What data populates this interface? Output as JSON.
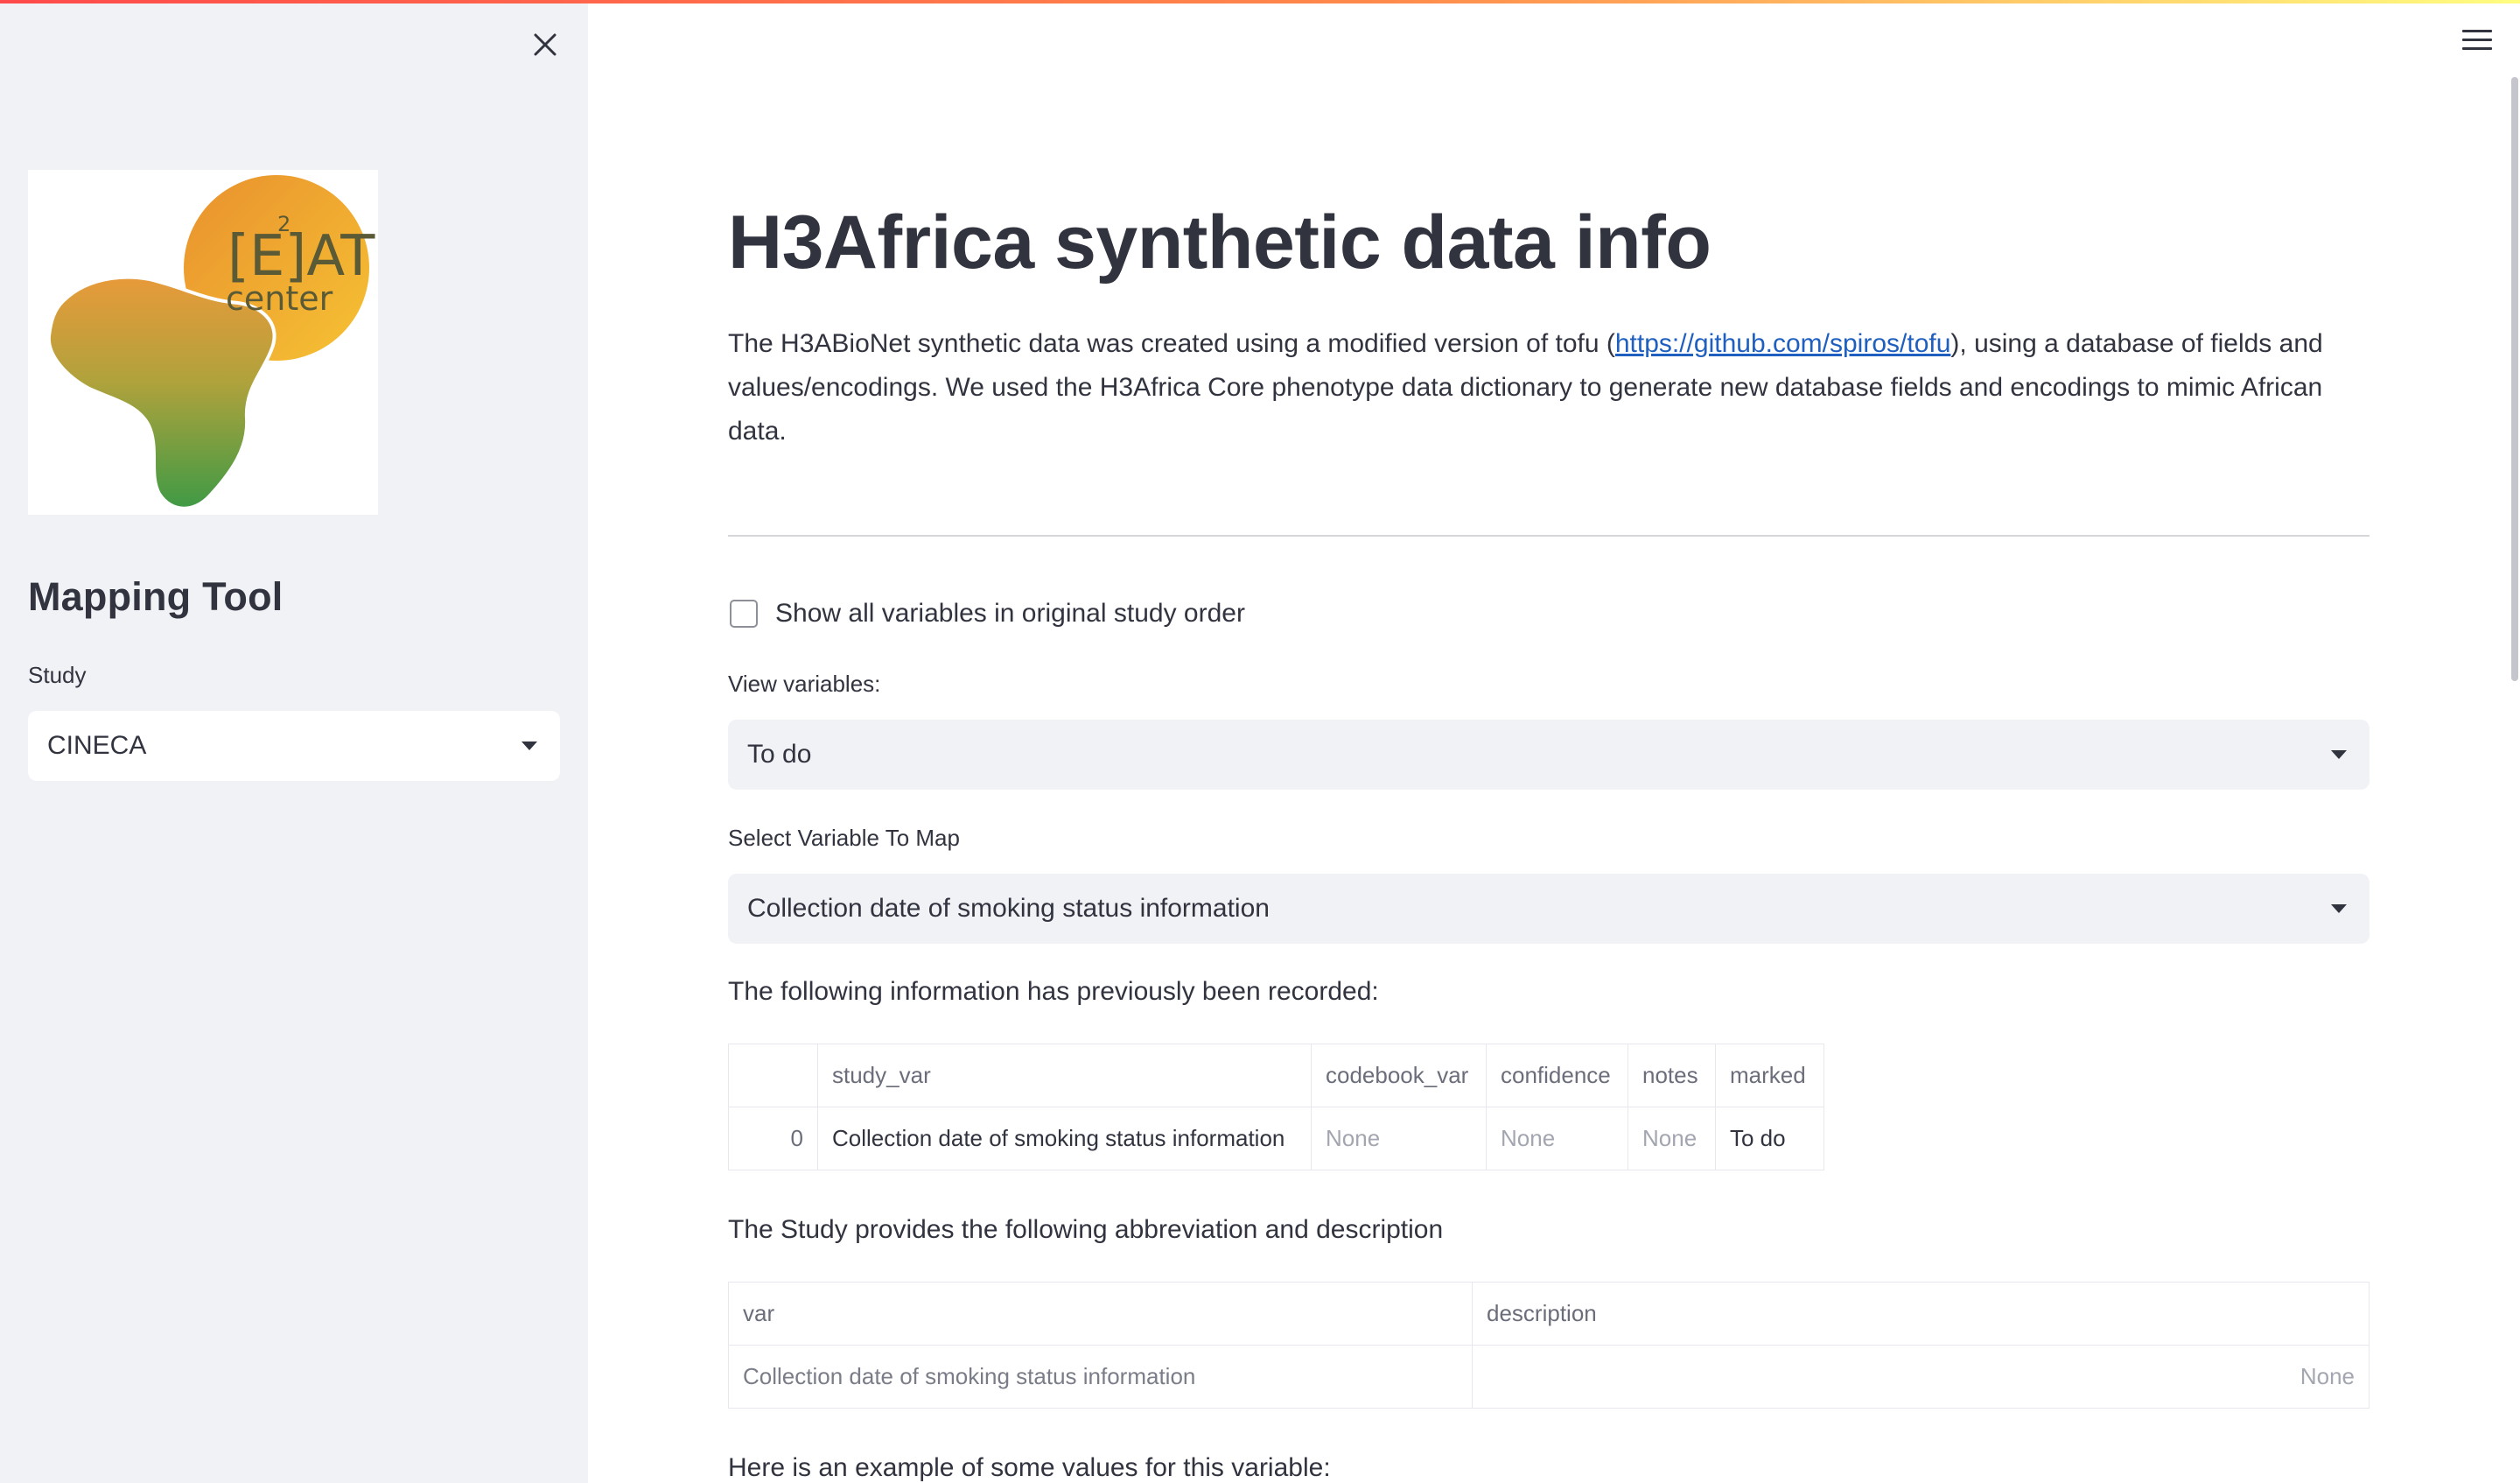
{
  "sidebar": {
    "logo_text": "HE2AT center",
    "title": "Mapping Tool",
    "study_label": "Study",
    "study_value": "CINECA"
  },
  "main": {
    "title": "H3Africa synthetic data info",
    "intro_before": "The H3ABioNet synthetic data was created using a modified version of tofu (",
    "intro_link": "https://github.com/spiros/tofu",
    "intro_after": "), using a database of fields and values/encodings. We used the H3Africa Core phenotype data dictionary to generate new database fields and encodings to mimic African data.",
    "checkbox_label": "Show all variables in original study order",
    "view_label": "View variables:",
    "view_value": "To do",
    "select_label": "Select Variable To Map",
    "select_value": "Collection date of smoking status information",
    "recorded_heading": "The following information has previously been recorded:",
    "recorded_table": {
      "headers": [
        "",
        "study_var",
        "codebook_var",
        "confidence",
        "notes",
        "marked"
      ],
      "row": [
        "0",
        "Collection date of smoking status information",
        "None",
        "None",
        "None",
        "To do"
      ]
    },
    "desc_heading": "The Study provides the following abbreviation and description",
    "desc_table": {
      "headers": [
        "var",
        "description"
      ],
      "row": [
        "Collection date of smoking status information",
        "None"
      ]
    },
    "example_heading": "Here is an example of some values for this variable:"
  },
  "colors": {
    "sidebar_bg": "#f0f2f6",
    "accent_gradient": [
      "#ff4b4b",
      "#fffd80"
    ],
    "link": "#1f5fbf",
    "text": "#31333f"
  }
}
